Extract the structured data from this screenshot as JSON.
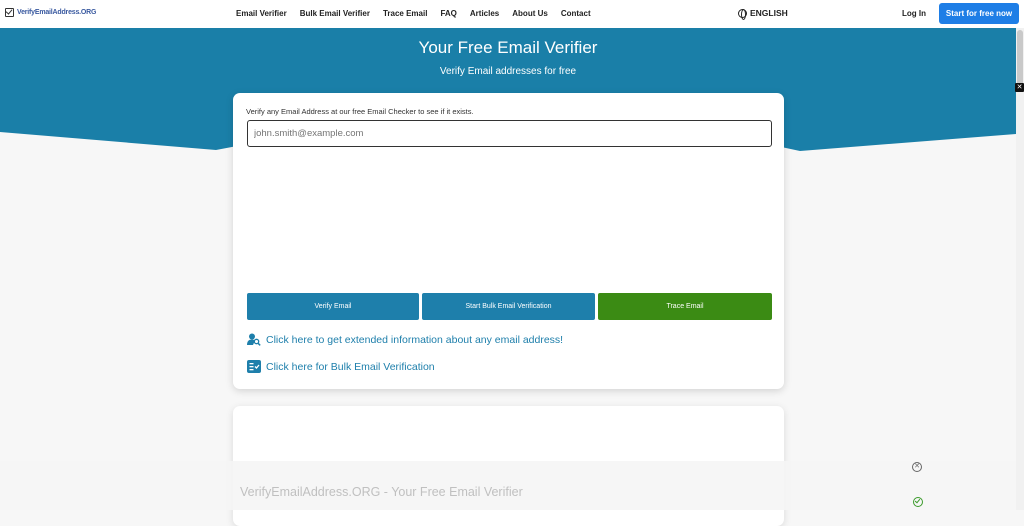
{
  "nav": {
    "logo_text": "VerifyEmailAddress.ORG",
    "links": [
      "Email Verifier",
      "Bulk Email Verifier",
      "Trace Email",
      "FAQ",
      "Articles",
      "About Us",
      "Contact"
    ],
    "language": "ENGLISH",
    "login": "Log In",
    "cta": "Start for free now"
  },
  "hero": {
    "title": "Your Free Email Verifier",
    "subtitle": "Verify Email addresses for free",
    "color": "#1a7fa8"
  },
  "card": {
    "label": "Verify any Email Address at our free Email Checker to see if it exists.",
    "input_placeholder": "john.smith@example.com",
    "buttons": {
      "verify": "Verify Email",
      "bulk": "Start Bulk Email Verification",
      "trace": "Trace Email"
    },
    "links": {
      "extended": "Click here to get extended information about any email address!",
      "bulk": "Click here for Bulk Email Verification"
    }
  },
  "footer_overlay": {
    "text": "VerifyEmailAddress.ORG - Your Free Email Verifier"
  },
  "colors": {
    "primary_blue": "#1e7fab",
    "cta_blue": "#1e7ee6",
    "trace_green": "#3b8b14"
  }
}
